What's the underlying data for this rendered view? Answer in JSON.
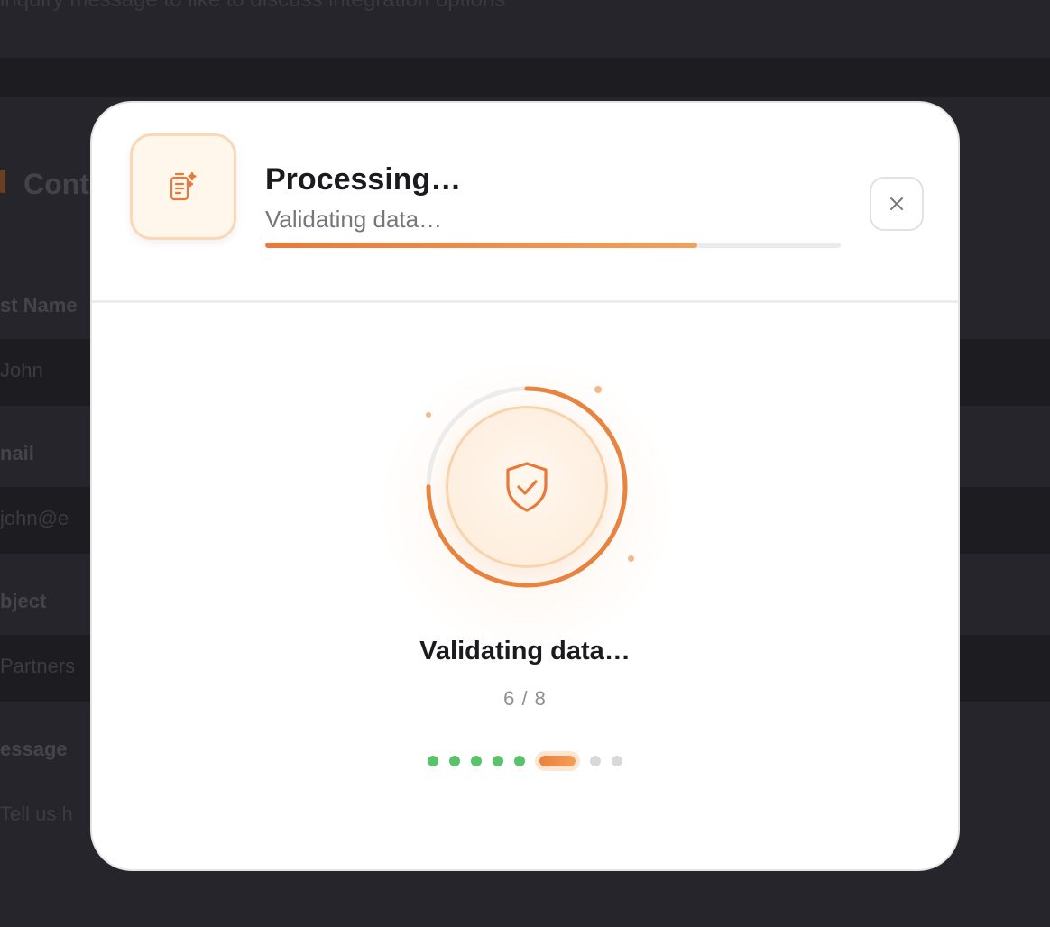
{
  "background": {
    "top_text": "inquiry message to like to discuss integration options",
    "section_title": "Cont",
    "fields": [
      {
        "label": "st Name",
        "value": "John"
      },
      {
        "label": "nail",
        "value": "john@e"
      },
      {
        "label": "bject",
        "value": "Partners"
      },
      {
        "label": "essage",
        "value": "Tell us h"
      }
    ]
  },
  "modal": {
    "title": "Processing…",
    "subtitle": "Validating data…",
    "progress": 0.75,
    "step_label": "Validating data…",
    "step_count": "6 / 8",
    "current_step": 6,
    "total_steps": 8,
    "close_label": "Close"
  },
  "colors": {
    "accent": "#e8793a",
    "done": "#5cc16b",
    "pending": "#d9d9dc",
    "backdrop": "#1c1c21"
  },
  "icons": {
    "header": "document-sparkle-icon",
    "center": "shield-check-icon",
    "close": "close-icon"
  }
}
